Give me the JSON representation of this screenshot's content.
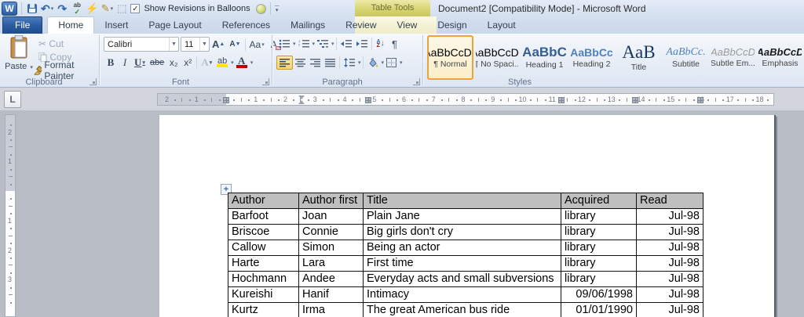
{
  "titlebar": {
    "contextual_label": "Table Tools",
    "title": "Document2 [Compatibility Mode]  -  Microsoft Word",
    "balloons_label": "Show Revisions in Balloons",
    "check": "✓"
  },
  "qat_glyphs": {
    "word_logo": "W",
    "undo": "↶",
    "redo": "↷",
    "spell_top": "ab",
    "spell_check": "✓",
    "lightning": "⚡",
    "pen": "✎",
    "select_table": "⬚",
    "more_dash": "—",
    "more_arrow": "▾"
  },
  "tabs": {
    "file": "File",
    "main": [
      "Home",
      "Insert",
      "Page Layout",
      "References",
      "Mailings",
      "Review",
      "View"
    ],
    "contextual": [
      "Design",
      "Layout"
    ],
    "active": "Home"
  },
  "ribbon": {
    "clipboard": {
      "label": "Clipboard",
      "paste": "Paste",
      "cut": "Cut",
      "copy": "Copy",
      "format_painter": "Format Painter",
      "cut_glyph": "✂"
    },
    "font": {
      "label": "Font",
      "family": "Calibri",
      "size": "11",
      "grow": "A",
      "shrink": "A",
      "case": "Aa",
      "clear": "A",
      "bold": "B",
      "italic": "I",
      "underline": "U",
      "strike": "abe",
      "subscript": "x₂",
      "superscript": "x²",
      "text_effects": "A",
      "highlight": "ab",
      "font_color": "A",
      "dropdown": "▾"
    },
    "paragraph": {
      "label": "Paragraph",
      "sort_a": "A",
      "sort_z": "Z",
      "sort_arrow": "↓",
      "pilcrow": "¶",
      "dropdown": "▾"
    },
    "styles": {
      "label": "Styles",
      "items": [
        {
          "sample": "AaBbCcDc",
          "name": "¶ Normal",
          "cls": "s-normal",
          "selected": true
        },
        {
          "sample": "AaBbCcDc",
          "name": "¶ No Spaci...",
          "cls": "s-normal",
          "selected": false
        },
        {
          "sample": "AaBbC",
          "name": "Heading 1",
          "cls": "s-h1",
          "selected": false
        },
        {
          "sample": "AaBbCc",
          "name": "Heading 2",
          "cls": "s-h2",
          "selected": false
        },
        {
          "sample": "AaB",
          "name": "Title",
          "cls": "s-title",
          "selected": false
        },
        {
          "sample": "AaBbCc.",
          "name": "Subtitle",
          "cls": "s-subtitle",
          "selected": false
        },
        {
          "sample": "AaBbCcD",
          "name": "Subtle Em...",
          "cls": "s-subtle",
          "selected": false
        },
        {
          "sample": "AaBbCcD",
          "name": "Emphasis",
          "cls": "s-emphasis",
          "selected": false
        }
      ]
    }
  },
  "ruler": {
    "tab_selector": "L",
    "h_gray_numbers": [
      "1",
      "2"
    ],
    "h_white_numbers": [
      "1",
      "2",
      "3",
      "4",
      "5",
      "6",
      "7",
      "8",
      "9",
      "10",
      "11",
      "12",
      "13",
      "14",
      "15",
      "16",
      "17",
      "18"
    ],
    "v_gray_numbers": [
      "1",
      "2"
    ],
    "v_white_numbers": [
      "1",
      "2",
      "3"
    ]
  },
  "document": {
    "move_handle": "+",
    "table": {
      "headers": [
        "Author",
        "Author first",
        "Title",
        "Acquired",
        "Read"
      ],
      "rows": [
        [
          "Barfoot",
          "Joan",
          "Plain Jane",
          "library",
          "Jul-98"
        ],
        [
          "Briscoe",
          "Connie",
          "Big girls don't cry",
          "library",
          "Jul-98"
        ],
        [
          "Callow",
          "Simon",
          "Being an actor",
          "library",
          "Jul-98"
        ],
        [
          "Harte",
          "Lara",
          "First time",
          "library",
          "Jul-98"
        ],
        [
          "Hochmann",
          "Andee",
          "Everyday acts and small subversions",
          "library",
          "Jul-98"
        ],
        [
          "Kureishi",
          "Hanif",
          "Intimacy",
          "09/06/1998",
          "Jul-98"
        ],
        [
          "Kurtz",
          "Irma",
          "The great American bus ride",
          "01/01/1990",
          "Jul-98"
        ]
      ]
    }
  },
  "colors": {
    "accent_blue": "#2b5da2",
    "contextual_yellow": "#d6d470",
    "style_selected_border": "#eca33d",
    "heading1": "#365f91",
    "heading2": "#4f81bd",
    "title_style": "#17365d",
    "font_color_red": "#c00000",
    "highlight_yellow": "#ffe600",
    "table_header_bg": "#bfbfbf"
  }
}
